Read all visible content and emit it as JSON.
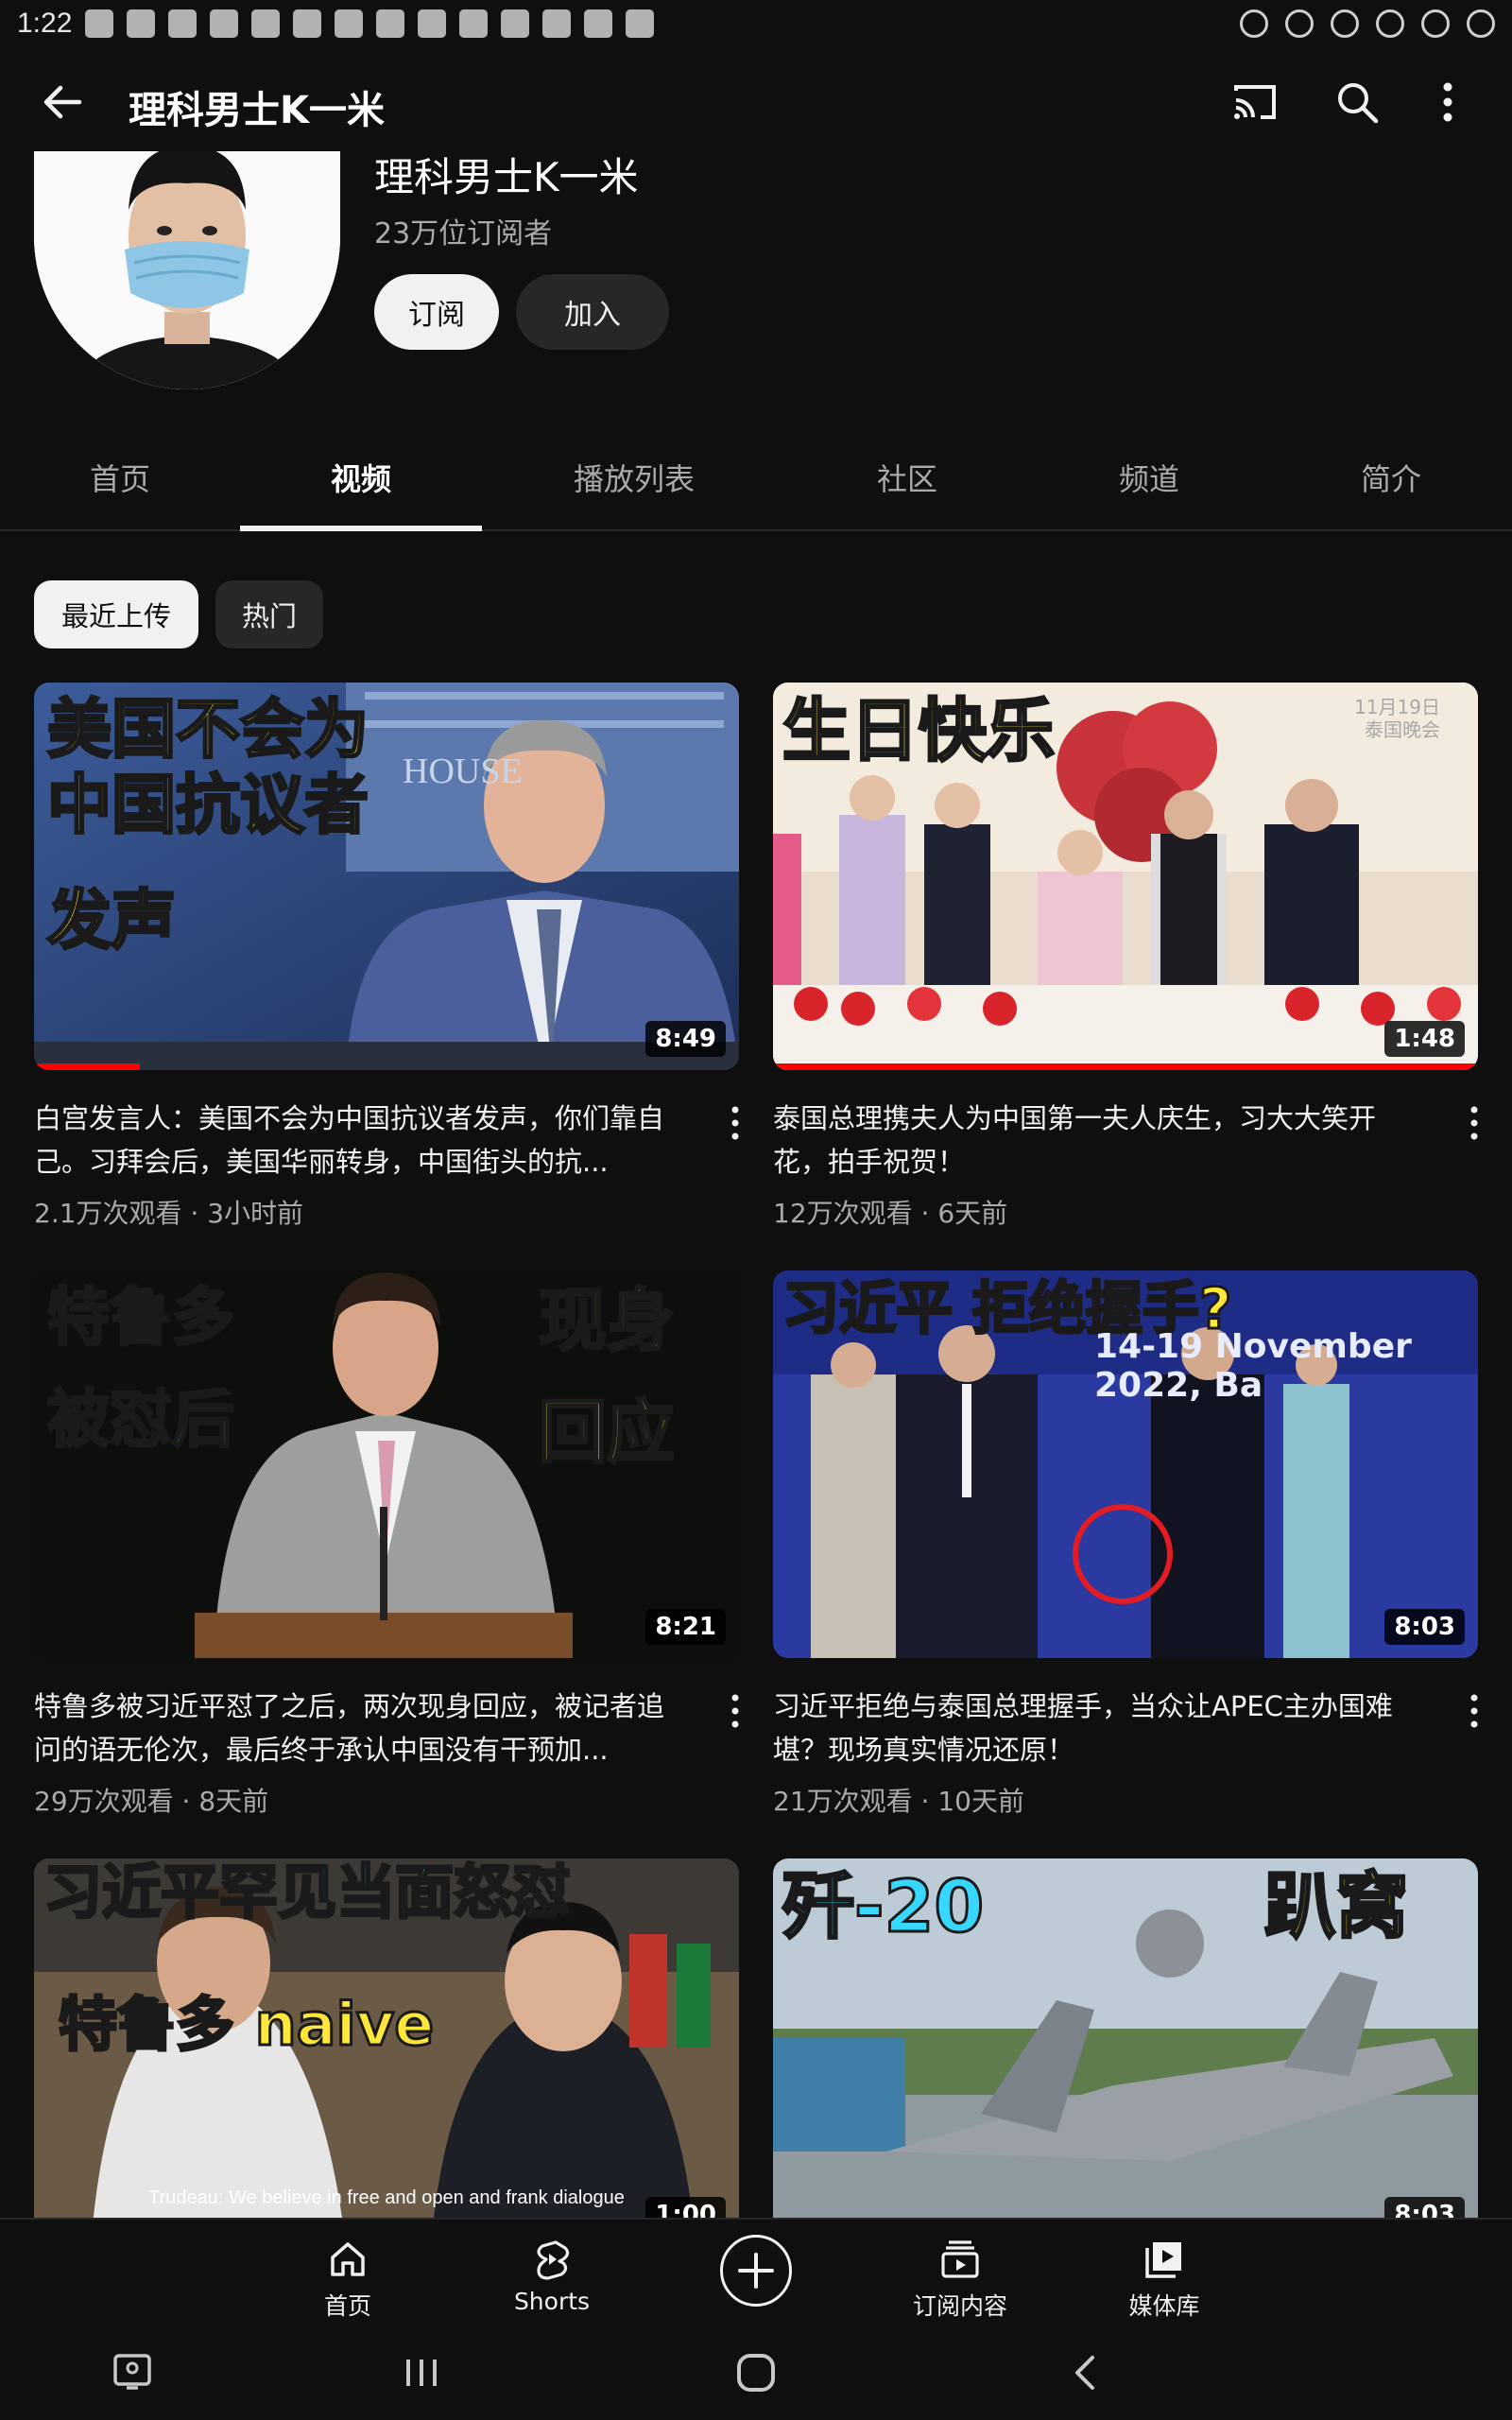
{
  "status_bar": {
    "time": "1:22"
  },
  "app_bar": {
    "title": "理科男士K一米"
  },
  "channel": {
    "name": "理科男士K一米",
    "subscribers": "23万位订阅者",
    "subscribe_label": "订阅",
    "join_label": "加入"
  },
  "tabs": [
    "首页",
    "视频",
    "播放列表",
    "社区",
    "频道",
    "简介"
  ],
  "active_tab": "视频",
  "chips": [
    "最近上传",
    "热门"
  ],
  "videos": [
    {
      "title": "白宫发言人：美国不会为中国抗议者发声，你们靠自己。习拜会后，美国华丽转身，中国街头的抗...",
      "views": "2.1万次观看",
      "age": "3小时前",
      "duration": "8:49",
      "watched_fraction": 0.15,
      "thumb_text": [
        "美国不会为",
        "中国抗议者",
        "发声"
      ],
      "thumb_bg_text": "HOUSE"
    },
    {
      "title": "泰国总理携夫人为中国第一夫人庆生，习大大笑开花，拍手祝贺！",
      "views": "12万次观看",
      "age": "6天前",
      "duration": "1:48",
      "watched_fraction": 1.0,
      "thumb_text": [
        "生日快乐"
      ],
      "thumb_corner_text": [
        "11月19日",
        "泰国晚会"
      ]
    },
    {
      "title": "特鲁多被习近平怼了之后，两次现身回应，被记者追问的语无伦次，最后终于承认中国没有干预加...",
      "views": "29万次观看",
      "age": "8天前",
      "duration": "8:21",
      "thumb_text_left": [
        "特鲁多",
        "被怼后"
      ],
      "thumb_text_right": [
        "现身",
        "回应"
      ]
    },
    {
      "title": "习近平拒绝与泰国总理握手，当众让APEC主办国难堪？现场真实情况还原！",
      "views": "21万次观看",
      "age": "10天前",
      "duration": "8:03",
      "thumb_text": [
        "习近平 拒绝握手?"
      ],
      "thumb_bg_text": "14-19 November 2022, Ba"
    },
    {
      "thumb_text": [
        "习近平罕见当面怒怼"
      ],
      "thumb_sub_text": "特鲁多 naive",
      "thumb_caption": "Trudeau: We believe in free and open and frank dialogue",
      "duration": "1:00"
    },
    {
      "thumb_text_left": "歼-20",
      "thumb_text_right": "趴窝",
      "duration": "8:03"
    }
  ],
  "bottom_nav": [
    {
      "label": "首页",
      "icon": "home-icon"
    },
    {
      "label": "Shorts",
      "icon": "shorts-icon"
    },
    {
      "label": "",
      "icon": "create-icon"
    },
    {
      "label": "订阅内容",
      "icon": "subscriptions-icon"
    },
    {
      "label": "媒体库",
      "icon": "library-icon"
    }
  ],
  "colors": {
    "background": "#0f0f0f",
    "progress": "#ff0000",
    "thumb_yellow": "#ffe63b",
    "thumb_cyan": "#38d7ff"
  }
}
